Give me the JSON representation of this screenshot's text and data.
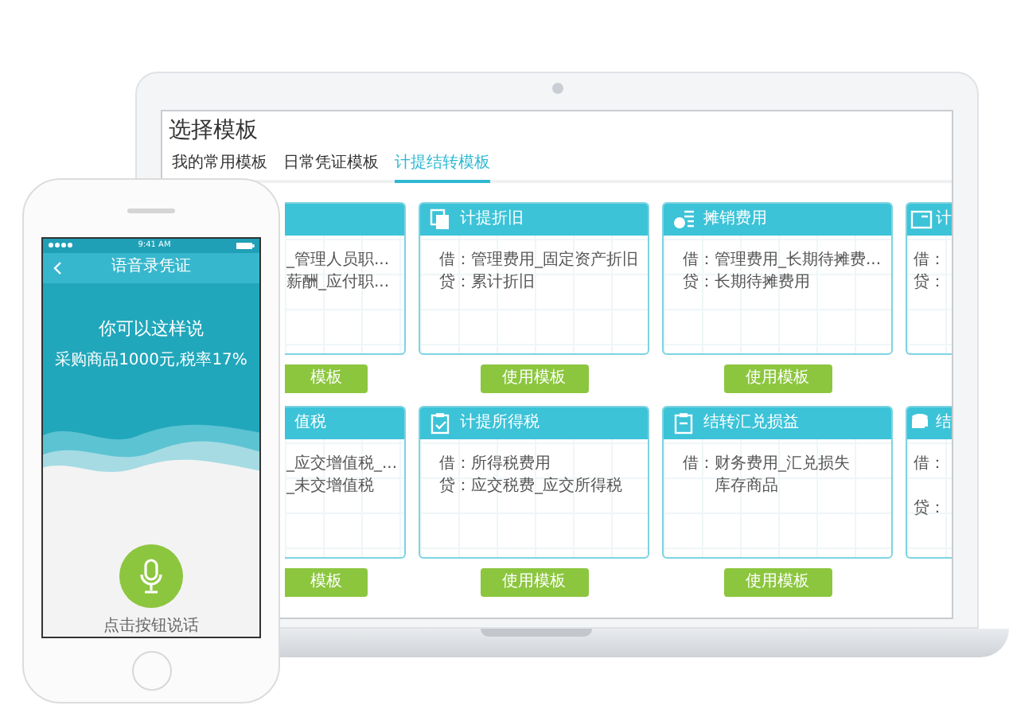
{
  "laptop": {
    "title": "选择模板",
    "tabs": [
      {
        "label": "我的常用模板",
        "selected": false
      },
      {
        "label": "日常凭证模板",
        "selected": false
      },
      {
        "label": "计提结转模板",
        "selected": true
      }
    ],
    "cards": [
      {
        "kind": "cut_left",
        "lines": [
          {
            "text": "_管理人员职...",
            "indent": false
          },
          {
            "text": "薪酬_应付职...",
            "indent": false
          }
        ],
        "button": "模板"
      },
      {
        "kind": "full",
        "title": "计提折旧",
        "lines": [
          {
            "text": "借：管理费用_固定资产折旧",
            "indent": false
          },
          {
            "text": "贷：累计折旧",
            "indent": false
          }
        ],
        "button": "使用模板"
      },
      {
        "kind": "full",
        "title": "摊销费用",
        "lines": [
          {
            "text": "借：管理费用_长期待摊费...",
            "indent": false
          },
          {
            "text": "贷：长期待摊费用",
            "indent": false
          }
        ],
        "button": "使用模板"
      },
      {
        "kind": "cut_right",
        "title": "计",
        "lines": [
          {
            "text": "借：",
            "indent": false
          },
          {
            "text": "贷：",
            "indent": false
          }
        ]
      },
      {
        "kind": "cut_left",
        "title": "值税",
        "lines": [
          {
            "text": "_应交增值税_...",
            "indent": false
          },
          {
            "text": "_未交增值税",
            "indent": false
          }
        ],
        "button": "模板"
      },
      {
        "kind": "full",
        "title": "计提所得税",
        "lines": [
          {
            "text": "借：所得税费用",
            "indent": false
          },
          {
            "text": "贷：应交税费_应交所得税",
            "indent": false
          }
        ],
        "button": "使用模板"
      },
      {
        "kind": "full",
        "title": "结转汇兑损益",
        "lines": [
          {
            "text": "借：财务费用_汇兑损失",
            "indent": false
          },
          {
            "text": "库存商品",
            "indent": true
          }
        ],
        "button": "使用模板"
      },
      {
        "kind": "cut_right",
        "title": "结",
        "lines": [
          {
            "text": "借：",
            "indent": false
          },
          {
            "text": "贷：",
            "indent": false
          }
        ]
      }
    ]
  },
  "phone": {
    "status_time": "9:41 AM",
    "nav_title": "语音录凭证",
    "prompt": "你可以这样说",
    "example": "采购商品1000元,税率17%",
    "hint": "点击按钮说话"
  }
}
